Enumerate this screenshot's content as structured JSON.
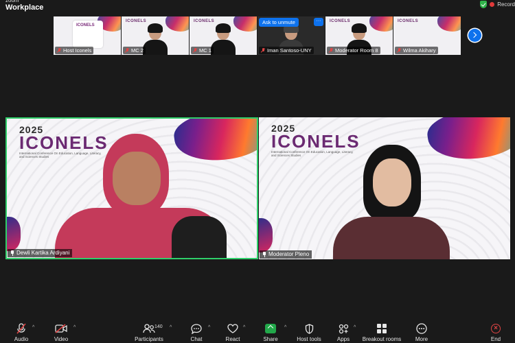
{
  "app": {
    "brand_top": "zoom",
    "brand_main": "Workplace",
    "recording": "Record"
  },
  "thumbnails": [
    {
      "name": "Host Iconels",
      "muted": true
    },
    {
      "name": "MC 2",
      "muted": true
    },
    {
      "name": "MC 1",
      "muted": true
    },
    {
      "name": "Iman Santoso-UNY",
      "muted": true,
      "overlay": "Ask to unmute",
      "more": "···"
    },
    {
      "name": "Moderator Room 8",
      "muted": true
    },
    {
      "name": "Wilma Akihary",
      "muted": true
    }
  ],
  "event_logo": {
    "year": "2025",
    "name": "ICONELS",
    "tagline": "International Conference On Education, Language, Literacy, and Sciences Studies"
  },
  "main_tiles": [
    {
      "name": "Dewli Kartika Ardiyani",
      "active_speaker": true
    },
    {
      "name": "Moderator Pleno",
      "active_speaker": false
    }
  ],
  "toolbar": {
    "audio": "Audio",
    "video": "Video",
    "participants": "Participants",
    "participants_count": "140",
    "chat": "Chat",
    "react": "React",
    "share": "Share",
    "host_tools": "Host tools",
    "apps": "Apps",
    "breakout_rooms": "Breakout rooms",
    "more": "More",
    "end": "End"
  },
  "colors": {
    "accent": "#0e72ed",
    "active_border": "#2fcf6a",
    "share": "#22a84a",
    "end": "#e04545",
    "brand": "#6b2a72"
  }
}
